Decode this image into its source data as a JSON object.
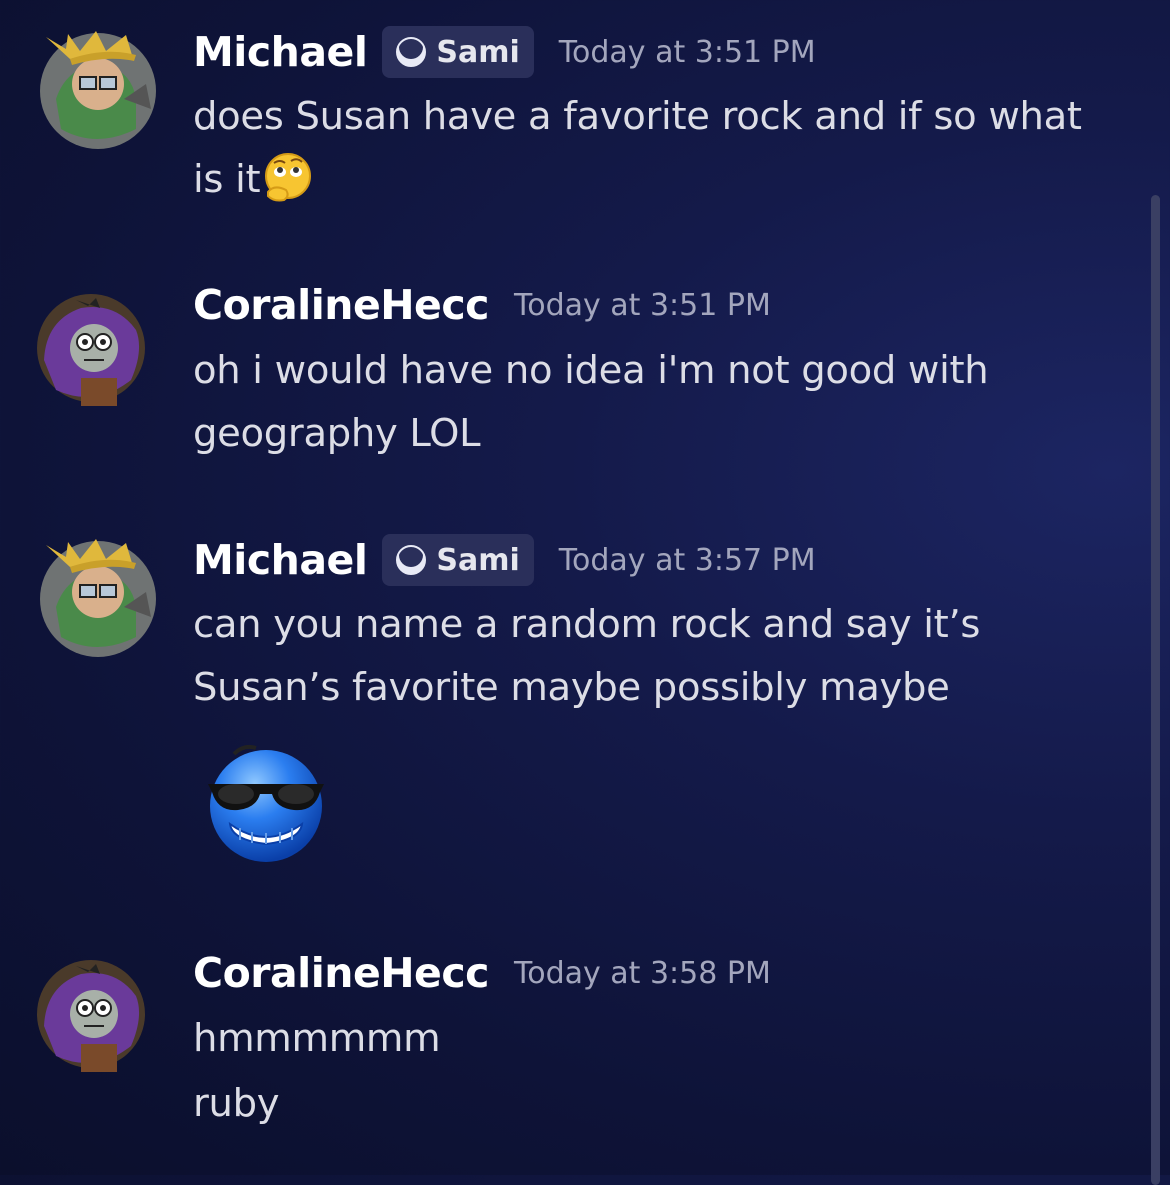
{
  "messages": [
    {
      "username": "Michael",
      "tag": "Sami",
      "timestamp": "Today at 3:51 PM",
      "lines": [
        "does Susan have a favorite rock and if so what",
        "is it"
      ],
      "emoji": "thinking-face-emoji"
    },
    {
      "username": "CoralineHecc",
      "timestamp": "Today at 3:51 PM",
      "lines": [
        "oh i would have no idea i'm not good with",
        "geography LOL"
      ]
    },
    {
      "username": "Michael",
      "tag": "Sami",
      "timestamp": "Today at 3:57 PM",
      "lines": [
        "can you name a random rock and say it’s",
        "Susan’s favorite maybe possibly maybe"
      ],
      "emoji": "cool-sunglasses-emoji"
    },
    {
      "username": "CoralineHecc",
      "timestamp": "Today at 3:58 PM",
      "lines": [
        "hmmmmmm",
        "ruby"
      ]
    }
  ],
  "colors": {
    "background": "#0e1338",
    "username": "#ffffff",
    "message_text": "#dcdde6",
    "timestamp": "#a3a6bd",
    "tag_background": "#2a2f5a"
  }
}
